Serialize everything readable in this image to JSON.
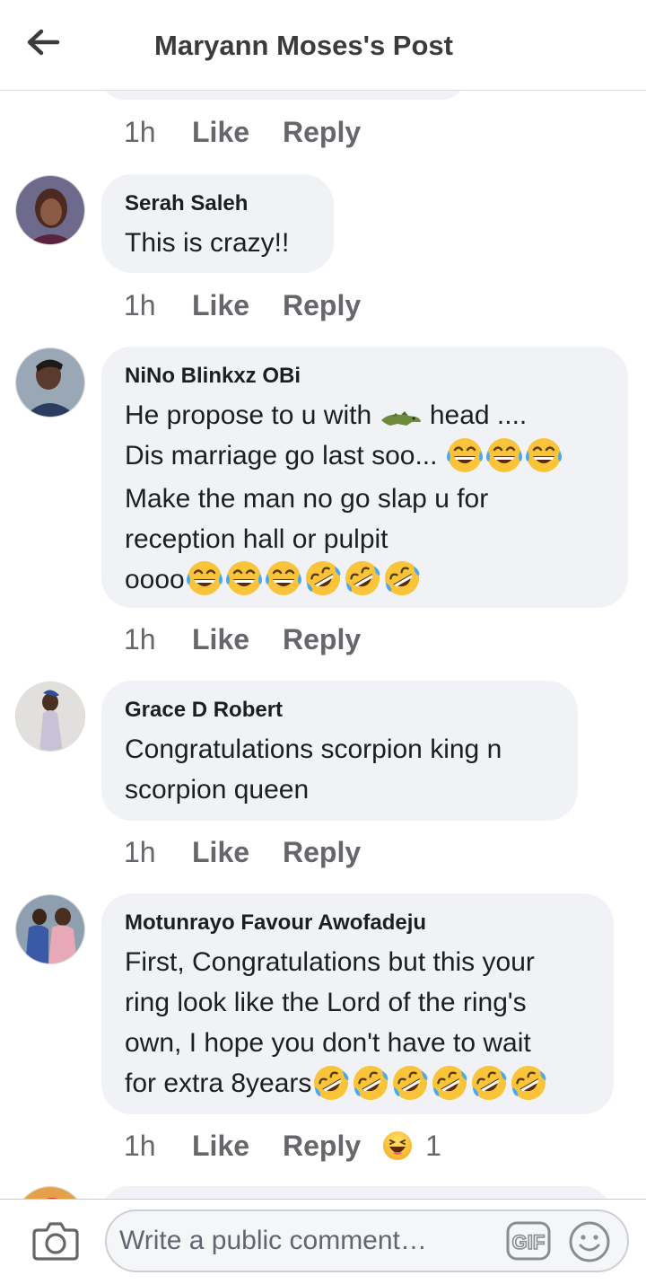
{
  "header": {
    "title": "Maryann Moses's Post",
    "back_icon": "arrow-left-icon"
  },
  "comments": [
    {
      "author": "",
      "time": "1h",
      "like": "Like",
      "reply": "Reply"
    },
    {
      "author": "Serah Saleh",
      "text": "This is crazy!!",
      "time": "1h",
      "like": "Like",
      "reply": "Reply"
    },
    {
      "author": "NiNo Blinkxz OBi",
      "line1a": "He propose to u with",
      "line1b": "head ....",
      "line2": "Dis marriage go last soo...",
      "line3": "Make the man no go slap u for",
      "line4": "reception hall or pulpit",
      "line5": "oooo",
      "emoji": [
        "crocodile",
        "joy",
        "rofl"
      ],
      "time": "1h",
      "like": "Like",
      "reply": "Reply"
    },
    {
      "author": "Grace D Robert",
      "line1": "Congratulations scorpion king n",
      "line2": "scorpion queen",
      "time": "1h",
      "like": "Like",
      "reply": "Reply"
    },
    {
      "author": "Motunrayo Favour Awofadeju",
      "line1": "First, Congratulations but this your",
      "line2": "ring look like the Lord of the ring's",
      "line3": "own, I hope you don't have to wait",
      "line4": "for extra 8years",
      "time": "1h",
      "like": "Like",
      "reply": "Reply",
      "reaction_count": "1",
      "reaction_icon": "haha-reaction-icon"
    }
  ],
  "composer": {
    "placeholder": "Write a public comment…",
    "camera_icon": "camera-icon",
    "gif_label": "GIF",
    "emoji_icon": "smiley-icon"
  },
  "colors": {
    "bubble": "#f0f2f5",
    "meta": "#65676b",
    "text": "#1c1e21"
  }
}
